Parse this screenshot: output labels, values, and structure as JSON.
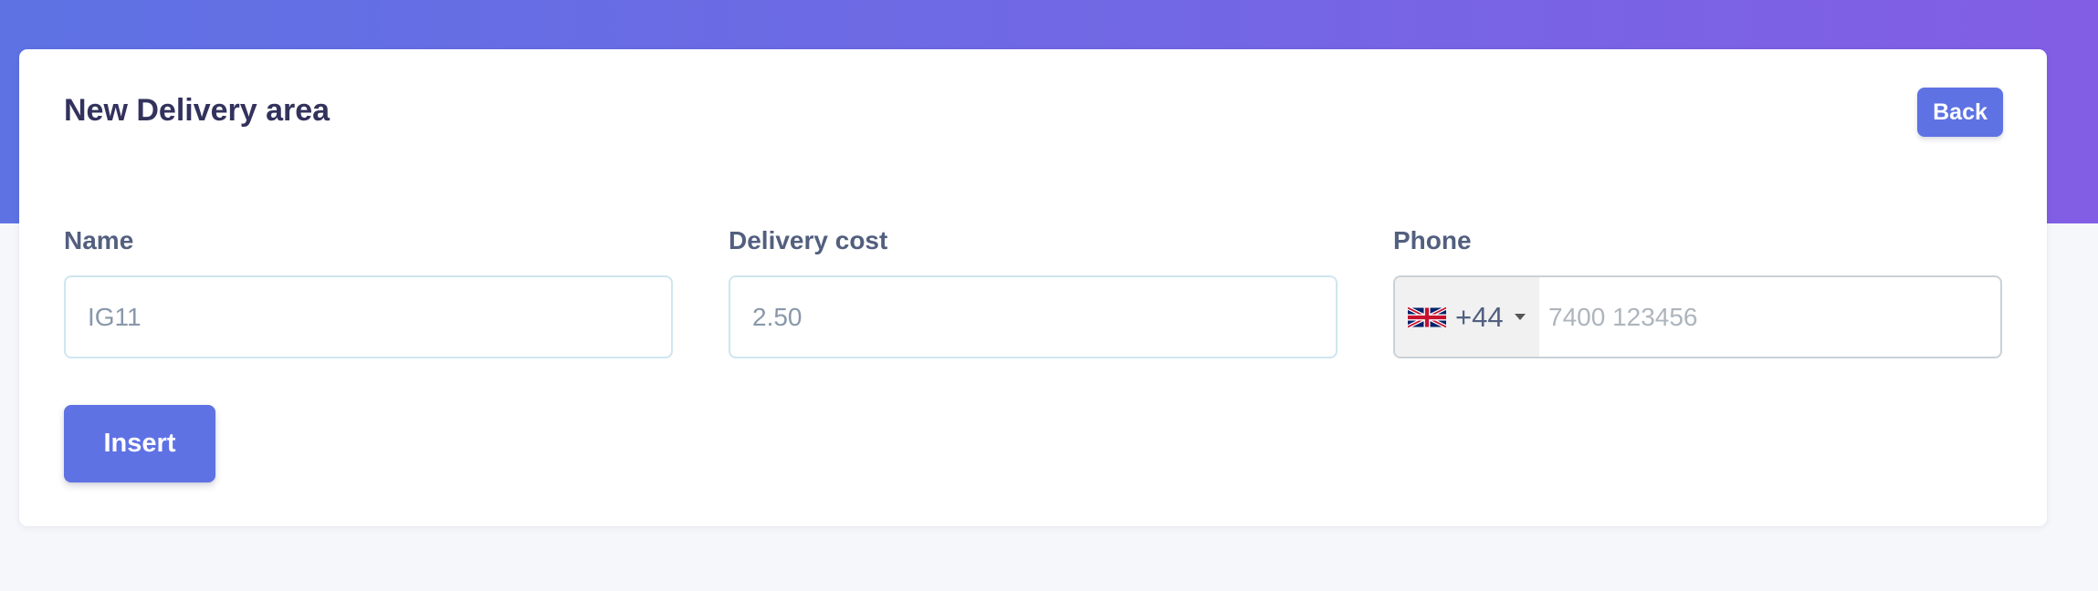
{
  "colors": {
    "accent": "#5e72e4",
    "gradient_start": "#5e72e4",
    "gradient_end": "#825ee4"
  },
  "card": {
    "title": "New Delivery area",
    "back_label": "Back"
  },
  "form": {
    "name": {
      "label": "Name",
      "value": "IG11"
    },
    "delivery_cost": {
      "label": "Delivery cost",
      "value": "2.50"
    },
    "phone": {
      "label": "Phone",
      "country_flag": "uk-flag-icon",
      "dial_code": "+44",
      "placeholder": "7400 123456"
    },
    "submit_label": "Insert"
  }
}
